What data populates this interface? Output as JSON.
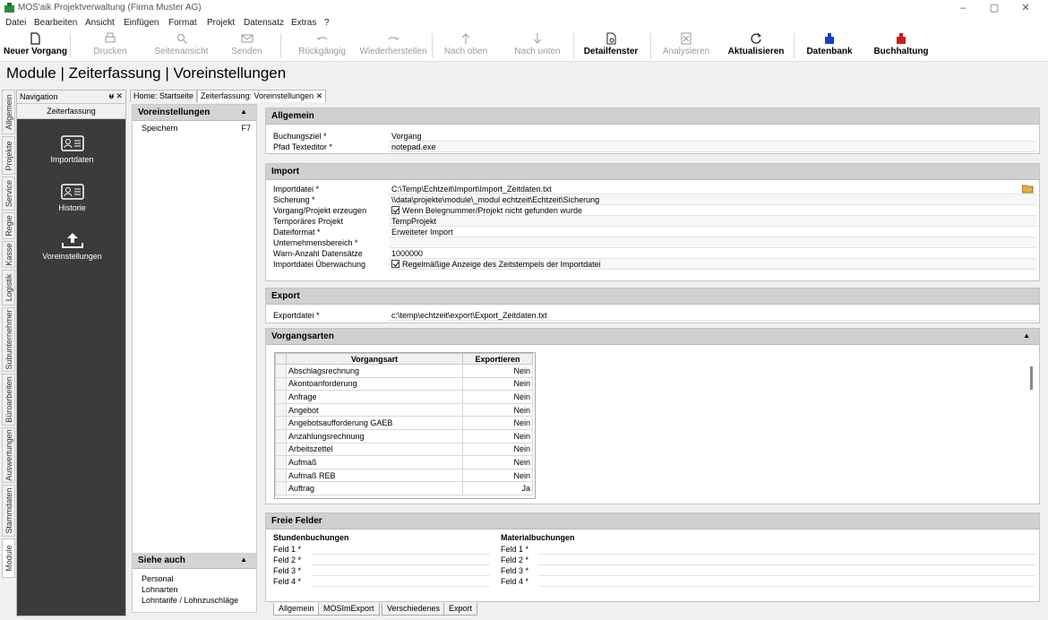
{
  "window": {
    "title": "MOS'aik Projektverwaltung (Firma Muster AG)",
    "minimize": "–",
    "restore": "▢",
    "close": "✕"
  },
  "menu": [
    "Datei",
    "Bearbeiten",
    "Ansicht",
    "Einfügen",
    "Format",
    "Projekt",
    "Datensatz",
    "Extras",
    "?"
  ],
  "toolbar": [
    {
      "label": "Neuer Vorgang",
      "icon": "new-document-icon",
      "enabled": true,
      "bold": true
    },
    {
      "label": "Drucken",
      "icon": "printer-icon",
      "enabled": false
    },
    {
      "label": "Seitenansicht",
      "icon": "page-preview-icon",
      "enabled": false
    },
    {
      "label": "Senden",
      "icon": "envelope-icon",
      "enabled": false
    },
    {
      "label": "Rückgängig",
      "icon": "undo-icon",
      "enabled": false
    },
    {
      "label": "Wiederherstellen",
      "icon": "redo-icon",
      "enabled": false
    },
    {
      "label": "Nach oben",
      "icon": "arrow-up-icon",
      "enabled": false
    },
    {
      "label": "Nach unten",
      "icon": "arrow-down-icon",
      "enabled": false
    },
    {
      "label": "Detailfenster",
      "icon": "detail-window-icon",
      "enabled": true,
      "bold": true
    },
    {
      "label": "Analysieren",
      "icon": "analyze-icon",
      "enabled": false
    },
    {
      "label": "Aktualisieren",
      "icon": "refresh-icon",
      "enabled": true,
      "bold": true
    },
    {
      "label": "Datenbank",
      "icon": "database-icon",
      "enabled": true,
      "bold": true,
      "color": "#1a3ccc"
    },
    {
      "label": "Buchhaltung",
      "icon": "accounting-icon",
      "enabled": true,
      "bold": true,
      "color": "#cc1a1a"
    }
  ],
  "page_title": "Module | Zeiterfassung | Voreinstellungen",
  "vtabs": [
    "Allgemein",
    "Projekte",
    "Service",
    "Regie",
    "Kasse",
    "Logistik",
    "Subunternehmer",
    "Büroarbeiten",
    "Auswertungen",
    "Stammdaten",
    "Module"
  ],
  "navigation": {
    "title": "Navigation",
    "pin": "ᵾ",
    "close": "✕",
    "module": "Zeiterfassung",
    "items": [
      {
        "label": "Importdaten",
        "icon": "id-card-icon"
      },
      {
        "label": "Historie",
        "icon": "id-card-icon"
      },
      {
        "label": "Voreinstellungen",
        "icon": "upload-tray-icon"
      }
    ]
  },
  "doc_tabs": [
    {
      "label": "Home: Startseite"
    },
    {
      "label": "Zeiterfassung: Voreinstellungen",
      "close": "✕"
    }
  ],
  "side_panel": {
    "title": "Voreinstellungen",
    "collapse": "▲",
    "items": [
      {
        "label": "Speichern",
        "shortcut": "F7"
      }
    ],
    "see_also": {
      "title": "Siehe auch",
      "collapse": "▲",
      "links": [
        "Personal",
        "Lohnarten",
        "Lohntarife / Lohnzuschläge"
      ]
    }
  },
  "allgemein": {
    "title": "Allgemein",
    "fields": [
      {
        "label": "Buchungsziel *",
        "value": "Vorgang"
      },
      {
        "label": "Pfad Texteditor *",
        "value": "notepad.exe"
      }
    ]
  },
  "import": {
    "title": "Import",
    "fields": [
      {
        "label": "Importdatei *",
        "value": "C:\\Temp\\Echtzeit\\Import\\Import_Zeitdaten.txt"
      },
      {
        "label": "Sicherung *",
        "value": "\\\\data\\projekte\\module\\_modul echtzeit\\Echtzeit\\Sicherung"
      },
      {
        "label": "Vorgang/Projekt erzeugen",
        "value": "Wenn Belegnummer/Projekt nicht gefunden wurde",
        "checked": true
      },
      {
        "label": "Temporäres Projekt",
        "value": "TempProjekt"
      },
      {
        "label": "Dateiformat *",
        "value": "Erweiteter Import"
      },
      {
        "label": "Unternehmensbereich *",
        "value": ""
      },
      {
        "label": "Warn-Anzahl Datensätze",
        "value": "1000000"
      },
      {
        "label": "Importdatei Überwachung",
        "value": "Regelmäßige Anzeige des Zeitstempels der Importdatei",
        "checked": true
      }
    ]
  },
  "export": {
    "title": "Export",
    "fields": [
      {
        "label": "Exportdatei *",
        "value": "c:\\temp\\echtzeit\\export\\Export_Zeitdaten.txt"
      }
    ]
  },
  "vorgangsarten": {
    "title": "Vorgangsarten",
    "collapse": "▲",
    "columns": [
      "Vorgangsart",
      "Exportieren"
    ],
    "rows": [
      [
        "Abschlagsrechnung",
        "Nein"
      ],
      [
        "Akontoanforderung",
        "Nein"
      ],
      [
        "Anfrage",
        "Nein"
      ],
      [
        "Angebot",
        "Nein"
      ],
      [
        "Angebotsaufforderung GAEB",
        "Nein"
      ],
      [
        "Anzahlungsrechnung",
        "Nein"
      ],
      [
        "Arbeitszettel",
        "Nein"
      ],
      [
        "Aufmaß",
        "Nein"
      ],
      [
        "Aufmaß REB",
        "Nein"
      ],
      [
        "Auftrag",
        "Ja"
      ]
    ]
  },
  "freie_felder": {
    "title": "Freie Felder",
    "stunden": {
      "title": "Stundenbuchungen",
      "labels": [
        "Feld 1 *",
        "Feld 2 *",
        "Feld 3 *",
        "Feld 4 *"
      ]
    },
    "material": {
      "title": "Materialbuchungen",
      "labels": [
        "Feld 1 *",
        "Feld 2 *",
        "Feld 3 *",
        "Feld 4 *"
      ]
    }
  },
  "bottom_tabs": [
    "Allgemein",
    "MOSImExport",
    "Verschiedenes",
    "Export"
  ]
}
